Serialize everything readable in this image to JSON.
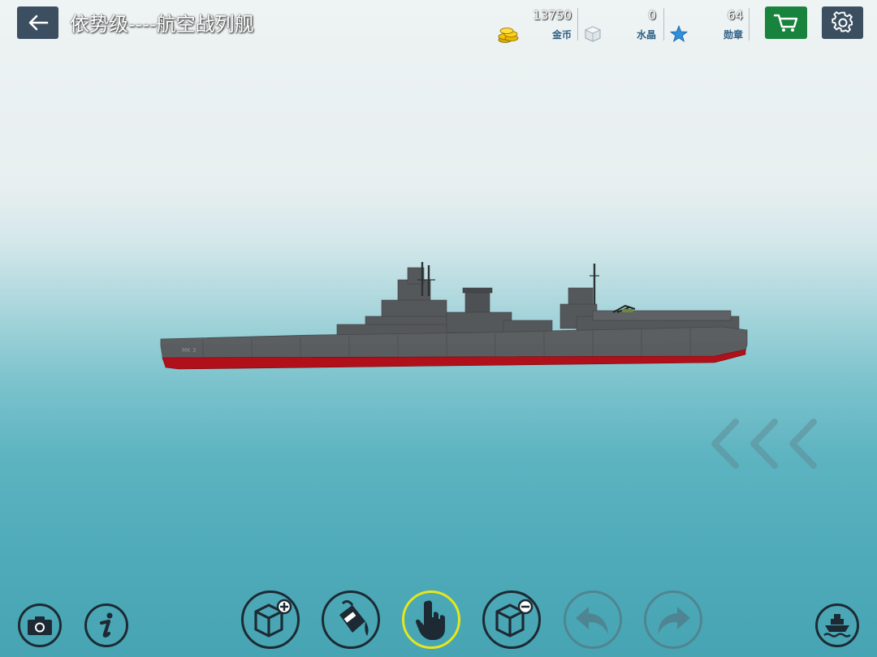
{
  "header": {
    "title": "依势级----航空战列舰"
  },
  "resources": {
    "gold": {
      "value": "13750",
      "label": "金币",
      "icon": "gold-coins-icon"
    },
    "crystal": {
      "value": "0",
      "label": "水晶",
      "icon": "crystal-icon"
    },
    "medals": {
      "value": "64",
      "label": "勋章",
      "icon": "star-icon"
    }
  },
  "ship": {
    "hull_marking": "MK 3"
  },
  "toolbar": {
    "left": [
      "camera-icon",
      "info-icon"
    ],
    "center": [
      "add-block-icon",
      "paint-bucket-icon",
      "hand-pointer-icon",
      "remove-block-icon",
      "undo-icon",
      "redo-icon"
    ],
    "selected_tool": "hand-pointer-icon",
    "disabled_tools": [
      "undo-icon",
      "redo-icon"
    ],
    "right": [
      "launch-ship-icon"
    ]
  },
  "colors": {
    "button_dark": "#3b4f60",
    "shop_green": "#17833d",
    "label_blue": "#2d5f86",
    "hull_red": "#b0101a",
    "hull_gray": "#5c5f62",
    "selected_ring": "#e6e61a"
  }
}
